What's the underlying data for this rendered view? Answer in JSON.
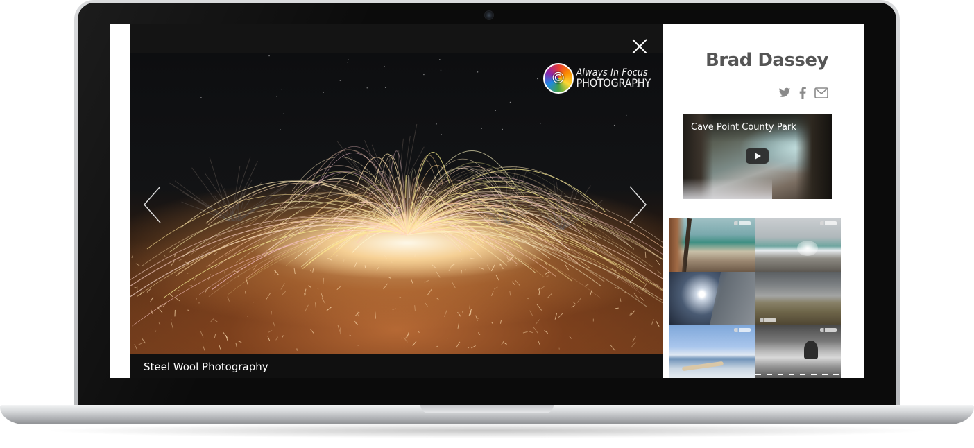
{
  "lightbox": {
    "caption": "Steel Wool Photography",
    "watermark": {
      "line1": "Always In Focus",
      "line2": "PHOTOGRAPHY"
    },
    "close_icon": "close-icon",
    "prev_icon": "chevron-left-icon",
    "next_icon": "chevron-right-icon"
  },
  "sidebar": {
    "author_name": "Brad Dassey",
    "social": [
      {
        "icon": "twitter-icon"
      },
      {
        "icon": "facebook-icon"
      },
      {
        "icon": "email-icon"
      }
    ],
    "video": {
      "title": "Cave Point County Park",
      "play_icon": "play-icon"
    },
    "gallery_count": 6
  },
  "colors": {
    "lightbox_bg": "#101010",
    "author_text": "#555555",
    "icon_gray": "#888888"
  }
}
